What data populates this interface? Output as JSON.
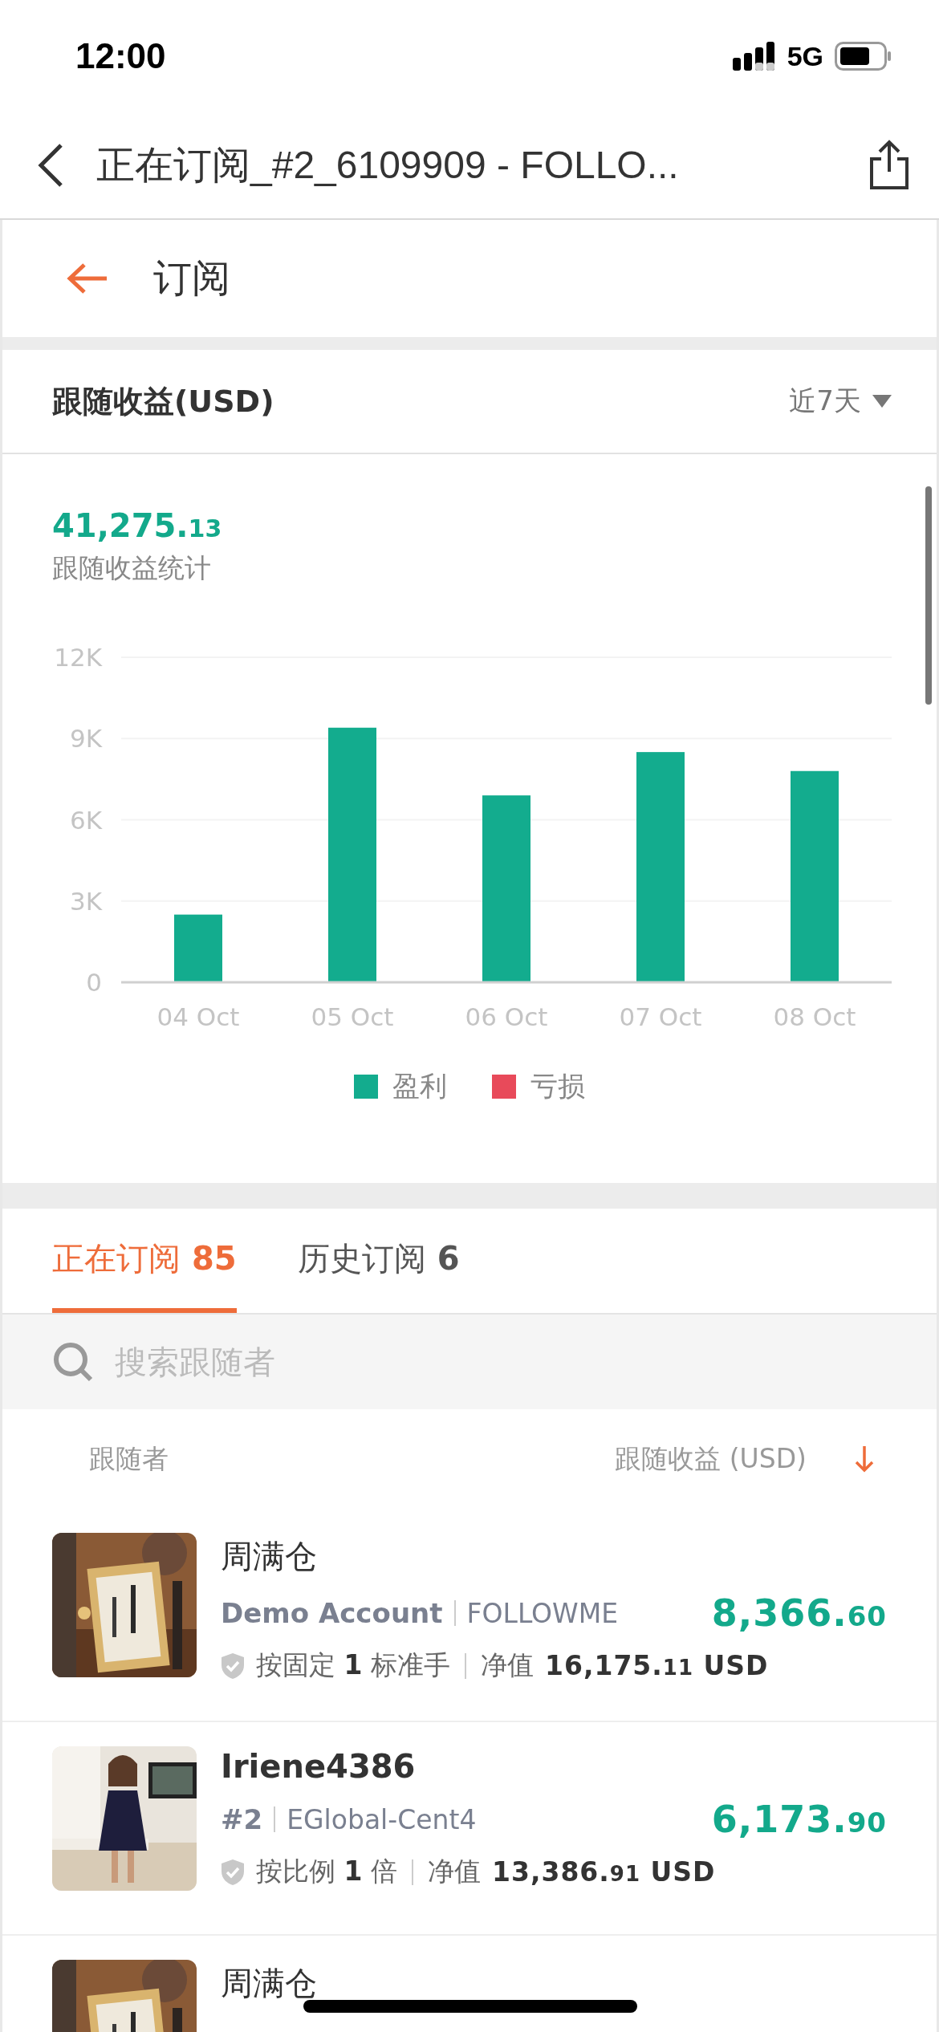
{
  "status_bar": {
    "time": "12:00",
    "network": "5G"
  },
  "nav_bar": {
    "title": "正在订阅_#2_6109909 - FOLLO..."
  },
  "page_header": {
    "title": "订阅"
  },
  "earnings": {
    "title": "跟随收益(USD)",
    "period": "近7天",
    "total": "41,275.13",
    "total_label": "跟随收益统计",
    "chart_data": {
      "type": "bar",
      "categories": [
        "04 Oct",
        "05 Oct",
        "06 Oct",
        "07 Oct",
        "08 Oct"
      ],
      "series": [
        {
          "name": "盈利",
          "color": "#13ac8e",
          "values": [
            2500,
            9400,
            6900,
            8500,
            7800
          ]
        },
        {
          "name": "亏损",
          "color": "#e84a5a",
          "values": [
            0,
            0,
            0,
            0,
            0
          ]
        }
      ],
      "ylim": [
        0,
        12000
      ],
      "grid": true,
      "yticks": [
        {
          "value": 0,
          "label": "0"
        },
        {
          "value": 3000,
          "label": "3K"
        },
        {
          "value": 6000,
          "label": "6K"
        },
        {
          "value": 9000,
          "label": "9K"
        },
        {
          "value": 12000,
          "label": "12K"
        }
      ]
    }
  },
  "tabs": [
    {
      "label": "正在订阅",
      "count": "85",
      "selected": true
    },
    {
      "label": "历史订阅",
      "count": "6",
      "selected": false
    }
  ],
  "search": {
    "placeholder": "搜索跟随者"
  },
  "columns": {
    "left": "跟随者",
    "right": "跟随收益 (USD)"
  },
  "followers": [
    {
      "name": "周满仓",
      "account": "Demo Account",
      "server": "FOLLOWME",
      "amount": "8,366.60",
      "mode": "按固定 **1** 标准手",
      "equity_label": "净值",
      "equity": "16,175.11",
      "currency": "USD"
    },
    {
      "name": "Iriene4386",
      "account": "#2",
      "server": "EGlobal-Cent4",
      "amount": "6,173.90",
      "mode": "按比例 **1** 倍",
      "equity_label": "净值",
      "equity": "13,386.91",
      "currency": "USD"
    },
    {
      "name": "周满仓"
    }
  ]
}
